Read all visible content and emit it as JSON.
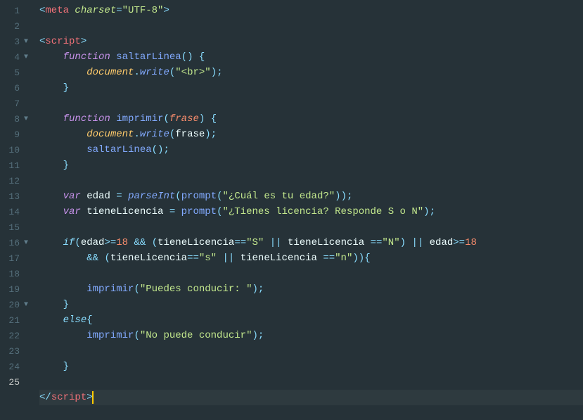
{
  "editor": {
    "activeLine": 25,
    "gutter": [
      {
        "n": 1,
        "fold": ""
      },
      {
        "n": 2,
        "fold": ""
      },
      {
        "n": 3,
        "fold": "▼"
      },
      {
        "n": 4,
        "fold": "▼"
      },
      {
        "n": 5,
        "fold": ""
      },
      {
        "n": 6,
        "fold": ""
      },
      {
        "n": 7,
        "fold": ""
      },
      {
        "n": 8,
        "fold": "▼"
      },
      {
        "n": 9,
        "fold": ""
      },
      {
        "n": 10,
        "fold": ""
      },
      {
        "n": 11,
        "fold": ""
      },
      {
        "n": 12,
        "fold": ""
      },
      {
        "n": 13,
        "fold": ""
      },
      {
        "n": 14,
        "fold": ""
      },
      {
        "n": 15,
        "fold": ""
      },
      {
        "n": 16,
        "fold": "▼"
      },
      {
        "n": 17,
        "fold": ""
      },
      {
        "n": 18,
        "fold": ""
      },
      {
        "n": 19,
        "fold": ""
      },
      {
        "n": 20,
        "fold": "▼"
      },
      {
        "n": 21,
        "fold": ""
      },
      {
        "n": 22,
        "fold": ""
      },
      {
        "n": 23,
        "fold": ""
      },
      {
        "n": 24,
        "fold": ""
      },
      {
        "n": 25,
        "fold": ""
      }
    ],
    "tokens": {
      "lt": "<",
      "gt": ">",
      "lts": "</",
      "meta": "meta",
      "script": "script",
      "charset_attr": "charset",
      "eq": "=",
      "utf8": "\"UTF-8\"",
      "function_kw": "function",
      "var_kw": "var",
      "if_kw": "if",
      "else_kw": "else",
      "fn_saltar": "saltarLinea",
      "fn_imprimir": "imprimir",
      "paren_open": "(",
      "paren_close": ")",
      "brace_open": "{",
      "brace_close": "}",
      "param_frase": "frase",
      "document": "document",
      "write": "write",
      "semi": ";",
      "dot": ".",
      "str_br": "\"<br>\"",
      "edad": "edad",
      "tieneLicencia": "tieneLicencia",
      "parseInt": "parseInt",
      "prompt": "prompt",
      "str_edad_q": "\"¿Cuál es tu edad?\"",
      "str_lic_q": "\"¿Tienes licencia? Responde S o N\"",
      "num18": "18",
      "gte": ">=",
      "eqeq": "==",
      "and": "&&",
      "or": "||",
      "str_S": "\"S\"",
      "str_N": "\"N\"",
      "str_s": "\"s\"",
      "str_n": "\"n\"",
      "str_puede": "\"Puedes conducir: \"",
      "str_nopuede": "\"No puede conducir\"",
      "sp1": " ",
      "sp4": "    ",
      "sp8": "        ",
      "sp12": "            "
    }
  }
}
